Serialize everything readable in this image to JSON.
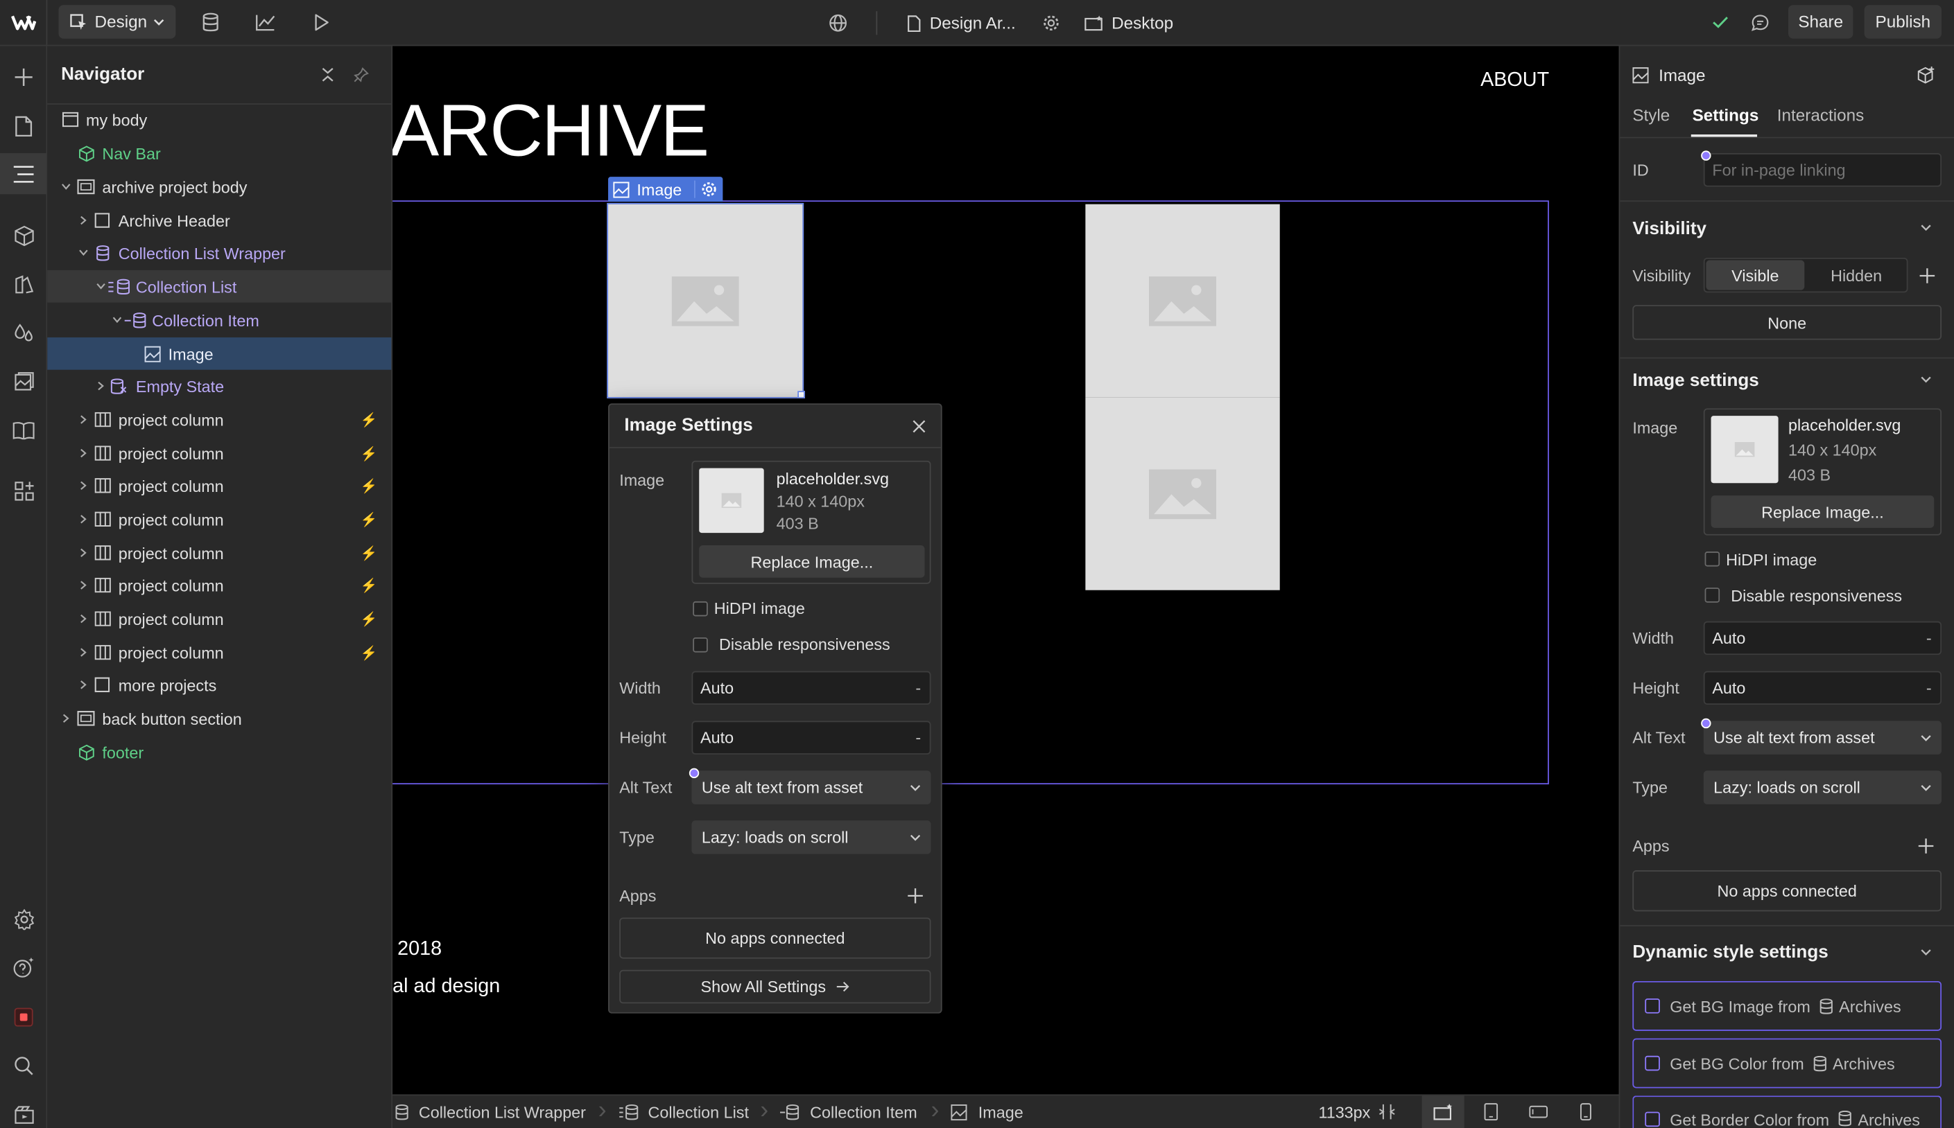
{
  "topbar": {
    "mode_label": "Design",
    "page_name": "Design Ar...",
    "breakpoint_label": "Desktop",
    "share_label": "Share",
    "publish_label": "Publish"
  },
  "navigator": {
    "title": "Navigator",
    "items": [
      {
        "label": "my body"
      },
      {
        "label": "Nav Bar"
      },
      {
        "label": "archive project body"
      },
      {
        "label": "Archive Header"
      },
      {
        "label": "Collection List Wrapper"
      },
      {
        "label": "Collection List"
      },
      {
        "label": "Collection Item"
      },
      {
        "label": "Image"
      },
      {
        "label": "Empty State"
      },
      {
        "label": "project column"
      },
      {
        "label": "project column"
      },
      {
        "label": "project column"
      },
      {
        "label": "project column"
      },
      {
        "label": "project column"
      },
      {
        "label": "project column"
      },
      {
        "label": "project column"
      },
      {
        "label": "project column"
      },
      {
        "label": "more projects"
      },
      {
        "label": "back button section"
      },
      {
        "label": "footer"
      }
    ]
  },
  "canvas": {
    "heading": "ARCHIVE",
    "about_link": "ABOUT",
    "selected_tag": "Image",
    "text_line1": ": 2018",
    "text_line2": "al ad design"
  },
  "popup": {
    "title": "Image Settings",
    "image_label": "Image",
    "file_name": "placeholder.svg",
    "file_dims": "140 x 140px",
    "file_size": "403 B",
    "replace_label": "Replace Image...",
    "hidpi_label": "HiDPI image",
    "disable_resp_label": "Disable responsiveness",
    "width_label": "Width",
    "width_value": "Auto",
    "height_label": "Height",
    "height_value": "Auto",
    "alt_label": "Alt Text",
    "alt_value": "Use alt text from asset",
    "type_label": "Type",
    "type_value": "Lazy: loads on scroll",
    "apps_label": "Apps",
    "no_apps": "No apps connected",
    "show_all": "Show All Settings"
  },
  "right_panel": {
    "element_title": "Image",
    "tabs": [
      "Style",
      "Settings",
      "Interactions"
    ],
    "id_label": "ID",
    "id_placeholder": "For in-page linking",
    "visibility_header": "Visibility",
    "visibility_label": "Visibility",
    "visible_option": "Visible",
    "hidden_option": "Hidden",
    "none_option": "None",
    "image_settings_header": "Image settings",
    "image_label": "Image",
    "file_name": "placeholder.svg",
    "file_dims": "140 x 140px",
    "file_size": "403 B",
    "replace_label": "Replace Image...",
    "hidpi_label": "HiDPI image",
    "disable_resp_label": "Disable responsiveness",
    "width_label": "Width",
    "width_value": "Auto",
    "height_label": "Height",
    "height_value": "Auto",
    "alt_label": "Alt Text",
    "alt_value": "Use alt text from asset",
    "type_label": "Type",
    "type_value": "Lazy: loads on scroll",
    "apps_label": "Apps",
    "no_apps": "No apps connected",
    "dynamic_header": "Dynamic style settings",
    "dynamic_items": [
      {
        "prefix": "Get BG Image from",
        "source": "Archives"
      },
      {
        "prefix": "Get BG Color from",
        "source": "Archives"
      },
      {
        "prefix": "Get Border Color from",
        "source": "Archives"
      }
    ]
  },
  "breadcrumbs": {
    "items": [
      "Collection List Wrapper",
      "Collection List",
      "Collection Item",
      "Image"
    ],
    "width_readout": "1133px"
  },
  "colors": {
    "accent": "#8f7bff",
    "selection": "#6e8cf0",
    "component_green": "#5fd088",
    "collection_purple": "#b9a8f5"
  }
}
